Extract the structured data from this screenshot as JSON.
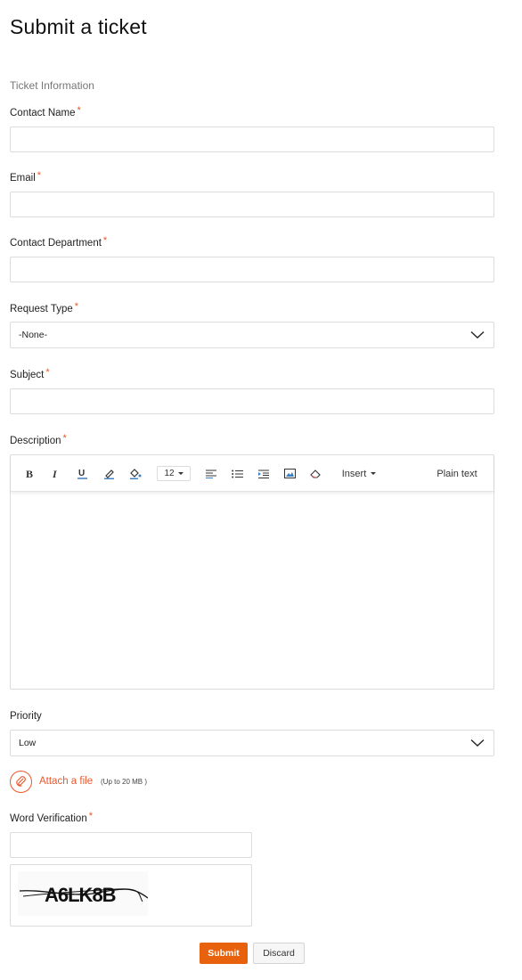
{
  "page": {
    "title": "Submit a ticket",
    "section": "Ticket Information"
  },
  "required_mark": "*",
  "fields": {
    "contact_name": {
      "label": "Contact Name",
      "value": ""
    },
    "email": {
      "label": "Email",
      "value": ""
    },
    "contact_department": {
      "label": "Contact Department",
      "value": ""
    },
    "request_type": {
      "label": "Request Type",
      "value": "-None-"
    },
    "subject": {
      "label": "Subject",
      "value": ""
    },
    "description": {
      "label": "Description"
    },
    "priority": {
      "label": "Priority",
      "value": "Low"
    },
    "word_verification": {
      "label": "Word Verification",
      "value": ""
    }
  },
  "editor": {
    "font_size": "12",
    "insert_label": "Insert",
    "plain_text_label": "Plain text",
    "tools": [
      "bold-icon",
      "italic-icon",
      "underline-icon",
      "text-color-icon",
      "background-color-icon",
      "font-size-select",
      "align-left-icon",
      "bulleted-list-icon",
      "indent-icon",
      "insert-image-icon",
      "clear-format-icon",
      "insert-menu",
      "plain-text-toggle"
    ]
  },
  "attach": {
    "label": "Attach a file",
    "note": "(Up to 20 MB )"
  },
  "captcha": {
    "text": "A6LK8B"
  },
  "buttons": {
    "submit": "Submit",
    "discard": "Discard"
  },
  "colors": {
    "accent": "#e8572b",
    "submit_bg": "#e8610c",
    "border": "#dcdcdc"
  }
}
